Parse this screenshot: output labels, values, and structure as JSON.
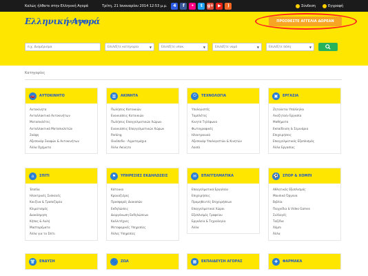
{
  "topbar": {
    "welcome": "Καλώς ήλθατε στην Ελληνική Αγορά",
    "date": "Τρίτη, 21 Ιανουαρίου 2014 12:53 μ.μ.",
    "social": [
      {
        "icon": "foursquare-icon",
        "glyph": "4",
        "color": "#2d5be3"
      },
      {
        "icon": "facebook-icon",
        "glyph": "f",
        "color": "#3b5998"
      },
      {
        "icon": "flickr-icon",
        "glyph": "•",
        "color": "#ff0084"
      },
      {
        "icon": "twitter-icon",
        "glyph": "t",
        "color": "#1da1f2"
      },
      {
        "icon": "google-plus-icon",
        "glyph": "g+",
        "color": "#dd4b39"
      },
      {
        "icon": "youtube-icon",
        "glyph": "▶",
        "color": "#e62117"
      },
      {
        "icon": "rss-icon",
        "glyph": ")",
        "color": "#f26522"
      }
    ],
    "login": "Σύνδεση",
    "register": "Εγγραφή"
  },
  "header": {
    "logo": "Ελληνική Αγορά",
    "logo_sub": "ΚΑΤΗΓΟΡΙΕΣ",
    "post_button": "ΠΡΟΣΘΕΣΤΕ ΑΓΓΕΛΙΑ ΔΩΡΕΑΝ"
  },
  "search": {
    "placeholder": "π.χ. Διαμέρισμα",
    "cat": "Επιλέξτε κατηγορία",
    "sub": "Επιλέξτε υποκ.",
    "region": "Επιλέξτε νομό",
    "city": "Επιλέξτε πόλη",
    "go_icon": "search-icon"
  },
  "categories_title": "Κατηγορίες",
  "cards": [
    {
      "title": "ΑΥΤΟΚΙΝΗΤΟ",
      "icon": "car-icon",
      "glyph": "🚗",
      "items": [
        "Αυτοκίνητα",
        "Ανταλλακτικά Αυτοκινήτων",
        "Μοτοσικλέτες",
        "Ανταλλακτικά Μοτοσικλετών",
        "Σκάφη",
        "Αξεσουάρ Σκαφών & Αυτοκινήτων",
        "Άλλα Οχήματα"
      ]
    },
    {
      "title": "ΑΚΙΝΗΤΑ",
      "icon": "building-icon",
      "glyph": "▥",
      "items": [
        "Πωλήσεις Κατοικιών",
        "Ενοικιάσεις Κατοικιών",
        "Πωλήσεις Επαγγελματικών Χώρων",
        "Ενοικιάσεις Επαγγελματικών Χώρων",
        "Parking",
        "Οικόπεδα - Αγροτεμάχια",
        "Άλλα Ακίνητα"
      ]
    },
    {
      "title": "ΤΕΧΝΟΛΟΓΙΑ",
      "icon": "power-icon",
      "glyph": "⏻",
      "items": [
        "Υπολογιστές",
        "Ταμπλέτες",
        "Κινητά Τηλέφωνα",
        "Φωτογραφικές",
        "Ηλεκτρονικά",
        "Αξεσουάρ Υπολογιστών & Κινητών",
        "Λοιπά"
      ]
    },
    {
      "title": "ΕΡΓΑΣΙΑ",
      "icon": "briefcase-icon",
      "glyph": "▣",
      "items": [
        "Ζητούνται Υπάλληλοι",
        "Αναζητούν Εργασία",
        "Μαθήματα",
        "Εκπαίδευση & Σεμινάρια",
        "Επιχειρήσεις",
        "Επαγγελματικός Εξοπλισμός",
        "Άλλα Εργασίας"
      ]
    },
    {
      "title": "ΣΠΙΤΙ",
      "icon": "house-icon",
      "glyph": "⌂",
      "items": [
        "Έπιπλα",
        "Ηλεκτρικές Συσκευές",
        "Κουζίνα & Τραπεζαρία",
        "Κλιματισμός",
        "Διακόσμηση",
        "Κήπος & Αυλή",
        "Μαστορέματα",
        "Άλλα για το Σπίτι"
      ]
    },
    {
      "title": "ΥΠΗΡΕΣΙΕΣ ΕΚΔΗΛΩΣΕΙΣ",
      "icon": "flag-icon",
      "glyph": "⚑",
      "items": [
        "Κάτοικοι",
        "Κρουαζιέρες",
        "Προσφορές Διακοπών",
        "Εκδηλώσεις",
        "Διοργάνωση Εκδηλώσεων",
        "Καλλιτέχνες",
        "Μεταφορικές Υπηρεσίες",
        "Άλλες Υπηρεσίες"
      ]
    },
    {
      "title": "ΕΠΑΓΓΕΛΜΑΤΙΚΑ",
      "icon": "handshake-icon",
      "glyph": "✉",
      "items": [
        "Επαγγελματικά Εργαλεία",
        "Επιχειρήσεις",
        "Προμηθευτές Επιχειρήσεων",
        "Επαγγελματικοί Χώροι",
        "Εξοπλισμός Γραφείου",
        "Εργαλεία & Τεχνολογία",
        "Άλλα"
      ]
    },
    {
      "title": "ΣΠΟΡ & ΧΟΜΠΙ",
      "icon": "ball-icon",
      "glyph": "⚽",
      "items": [
        "Αθλητικός Εξοπλισμός",
        "Μουσικά Όργανα",
        "Βιβλία",
        "Παιχνίδια & Video Games",
        "Συλλογές",
        "Ταξίδια",
        "Χόμπι",
        "Άλλα"
      ]
    },
    {
      "title": "ΕΝΔΥΣΗ",
      "icon": "shirt-icon",
      "glyph": "👕",
      "items": []
    },
    {
      "title": "ΖΩΑ",
      "icon": "paw-icon",
      "glyph": "🐾",
      "items": []
    },
    {
      "title": "ΕΚΠΑΙΔΕΥΣΗ ΑΓΟΡΑΣ",
      "icon": "calendar-icon",
      "glyph": "▦",
      "items": []
    },
    {
      "title": "ΦΑΡΜΑΚΑ",
      "icon": "cross-icon",
      "glyph": "✚",
      "items": []
    }
  ]
}
